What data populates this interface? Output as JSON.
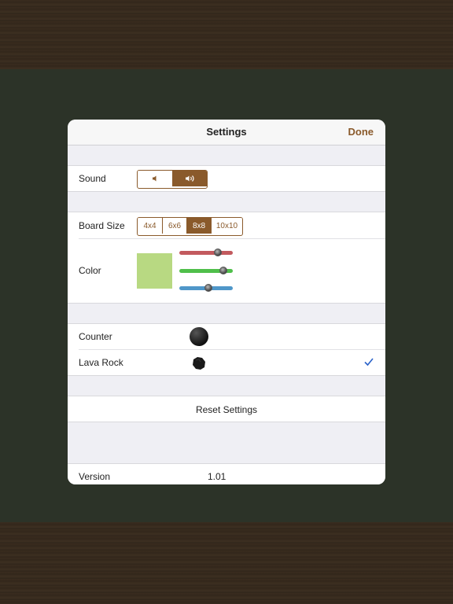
{
  "navbar": {
    "title": "Settings",
    "done_label": "Done"
  },
  "sound": {
    "label": "Sound",
    "options": [
      "mute",
      "on"
    ],
    "selected": "on"
  },
  "board_size": {
    "label": "Board Size",
    "options": [
      "4x4",
      "6x6",
      "8x8",
      "10x10"
    ],
    "selected": "8x8"
  },
  "color": {
    "label": "Color",
    "swatch": "#b8d982",
    "sliders": [
      {
        "name": "red",
        "track": "#c25a5e",
        "value": 0.72
      },
      {
        "name": "green",
        "track": "#4fbf4a",
        "value": 0.82
      },
      {
        "name": "blue",
        "track": "#4f97c9",
        "value": 0.55
      }
    ]
  },
  "pieces": [
    {
      "label": "Counter",
      "icon": "counter-icon",
      "checked": false
    },
    {
      "label": "Lava Rock",
      "icon": "lava-rock-icon",
      "checked": true
    }
  ],
  "reset_label": "Reset Settings",
  "version": {
    "label": "Version",
    "value": "1.01"
  },
  "colors": {
    "accent": "#8a5a2b",
    "check": "#2a62c9"
  }
}
